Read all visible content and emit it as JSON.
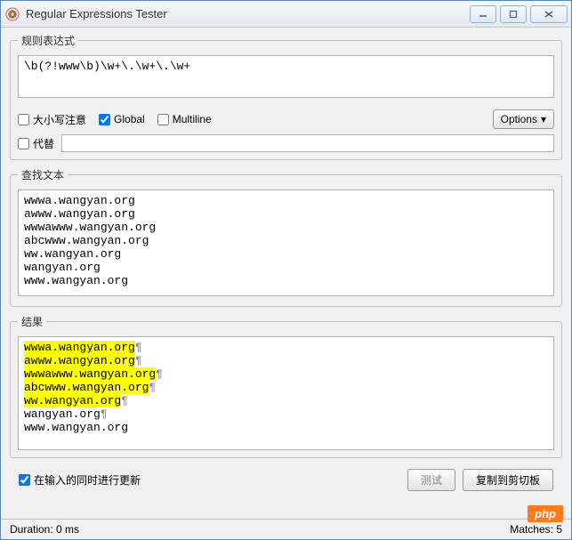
{
  "window": {
    "title": "Regular Expressions Tester"
  },
  "regex": {
    "legend": "规则表达式",
    "value": "\\b(?!www\\b)\\w+\\.\\w+\\.\\w+",
    "caseLabel": "大小写注意",
    "globalLabel": "Global",
    "multilineLabel": "Multiline",
    "optionsLabel": "Options",
    "subLabel": "代替",
    "subValue": ""
  },
  "search": {
    "legend": "查找文本",
    "text": "wwwa.wangyan.org\nawww.wangyan.org\nwwwawww.wangyan.org\nabcwww.wangyan.org\nww.wangyan.org\nwangyan.org\nwww.wangyan.org"
  },
  "result": {
    "legend": "结果",
    "lines": [
      {
        "match": "wwwa.wangyan.org",
        "pilcrow": true,
        "rest": ""
      },
      {
        "match": "awww.wangyan.org",
        "pilcrow": true,
        "rest": ""
      },
      {
        "match": "wwwawww.wangyan.org",
        "pilcrow": true,
        "rest": ""
      },
      {
        "match": "abcwww.wangyan.org",
        "pilcrow": true,
        "rest": ""
      },
      {
        "match": "ww.wangyan.org",
        "pilcrow": true,
        "rest": ""
      },
      {
        "match": "",
        "pilcrow": true,
        "rest": "wangyan.org"
      },
      {
        "match": "",
        "pilcrow": false,
        "rest": "www.wangyan.org"
      }
    ]
  },
  "bottom": {
    "autoLabel": "在输入的同时进行更新",
    "testLabel": "测试",
    "copyLabel": "复制到剪切板"
  },
  "status": {
    "duration": "Duration: 0 ms",
    "matches": "Matches: 5"
  },
  "badge": {
    "text": "php"
  }
}
